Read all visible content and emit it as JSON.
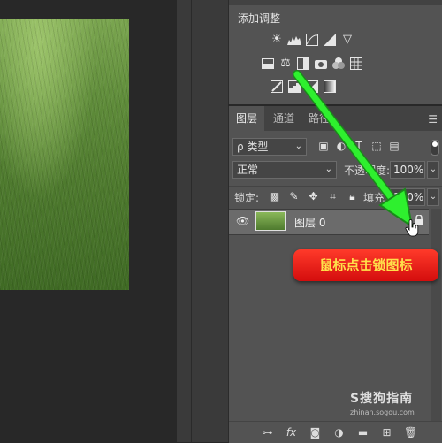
{
  "adjustments": {
    "title": "添加调整",
    "row1_icons": [
      "brightness-icon",
      "levels-icon",
      "curves-icon",
      "exposure-icon",
      "vibrance-icon"
    ],
    "row2_icons": [
      "hue-saturation-icon",
      "color-balance-icon",
      "black-white-icon",
      "photo-filter-icon",
      "channel-mixer-icon",
      "color-lookup-icon"
    ],
    "row3_icons": [
      "invert-icon",
      "posterize-icon",
      "threshold-icon",
      "gradient-map-icon"
    ]
  },
  "layers_panel": {
    "tabs": [
      {
        "label": "图层"
      },
      {
        "label": "通道"
      },
      {
        "label": "路径"
      }
    ],
    "filter": {
      "label": "ρ 类型"
    },
    "blend_mode": "正常",
    "opacity_label": "不透明度:",
    "opacity_value": "100%",
    "lock_label": "锁定:",
    "fill_label": "填充:",
    "fill_value": "100%",
    "layers": [
      {
        "name": "图层 0"
      }
    ]
  },
  "annotation": {
    "callout_text": "鼠标点击锁图标",
    "arrow_color": "#22ee22",
    "callout_color": "#e01a10",
    "callout_text_color": "#ffe04a"
  },
  "watermark": {
    "main": "S搜狗指南",
    "sub": "zhinan.sogou.com"
  }
}
